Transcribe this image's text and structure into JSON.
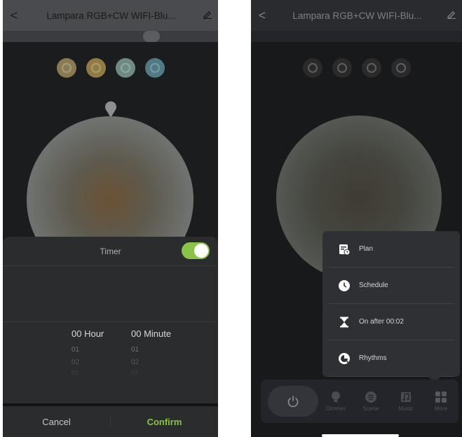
{
  "header": {
    "back_glyph": "<",
    "title": "Lampara RGB+CW WIFI-Blu...",
    "edit_icon": "edit-icon"
  },
  "scene_colors": [
    "#8a7a52",
    "#927a45",
    "#6f8a84",
    "#4f7a86"
  ],
  "timer_sheet": {
    "title": "Timer",
    "toggle_on": true,
    "picker": {
      "hour_label": "00 Hour",
      "minute_label": "00 Minute",
      "hour_options": [
        "01",
        "02",
        "03"
      ],
      "minute_options": [
        "01",
        "02",
        "03"
      ]
    },
    "cancel_label": "Cancel",
    "confirm_label": "Confirm"
  },
  "more_menu": {
    "items": [
      {
        "label": "Plan",
        "icon": "plan-icon"
      },
      {
        "label": "Schedule",
        "icon": "clock-icon"
      },
      {
        "label": "On after 00:02",
        "icon": "hourglass-icon"
      },
      {
        "label": "Rhythms",
        "icon": "rhythms-icon"
      }
    ]
  },
  "bottom_bar": {
    "tabs": [
      {
        "label": "Dimmer",
        "icon": "bulb-icon"
      },
      {
        "label": "Scene",
        "icon": "scene-icon"
      },
      {
        "label": "Music",
        "icon": "music-icon"
      },
      {
        "label": "More",
        "icon": "grid-icon"
      }
    ]
  },
  "colors": {
    "accent_green": "#8bc34a"
  }
}
